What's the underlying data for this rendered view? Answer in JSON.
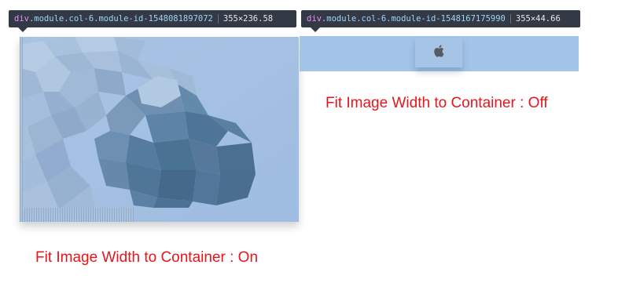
{
  "tooltips": {
    "left": {
      "tag": "div",
      "classes": ".module.col-6.module-id-1548081897072",
      "dims": "355×236.58"
    },
    "right": {
      "tag": "div",
      "classes": ".module.col-6.module-id-1548167175990",
      "dims": "355×44.66"
    }
  },
  "captions": {
    "left": "Fit Image Width to Container : On",
    "right": "Fit Image Width to Container : Off"
  },
  "icons": {
    "right_module_icon": "apple-logo-icon"
  },
  "colors": {
    "caption": "#e8141b",
    "module_bg": "#a3bfe2",
    "tooltip_bg": "#333a45"
  }
}
